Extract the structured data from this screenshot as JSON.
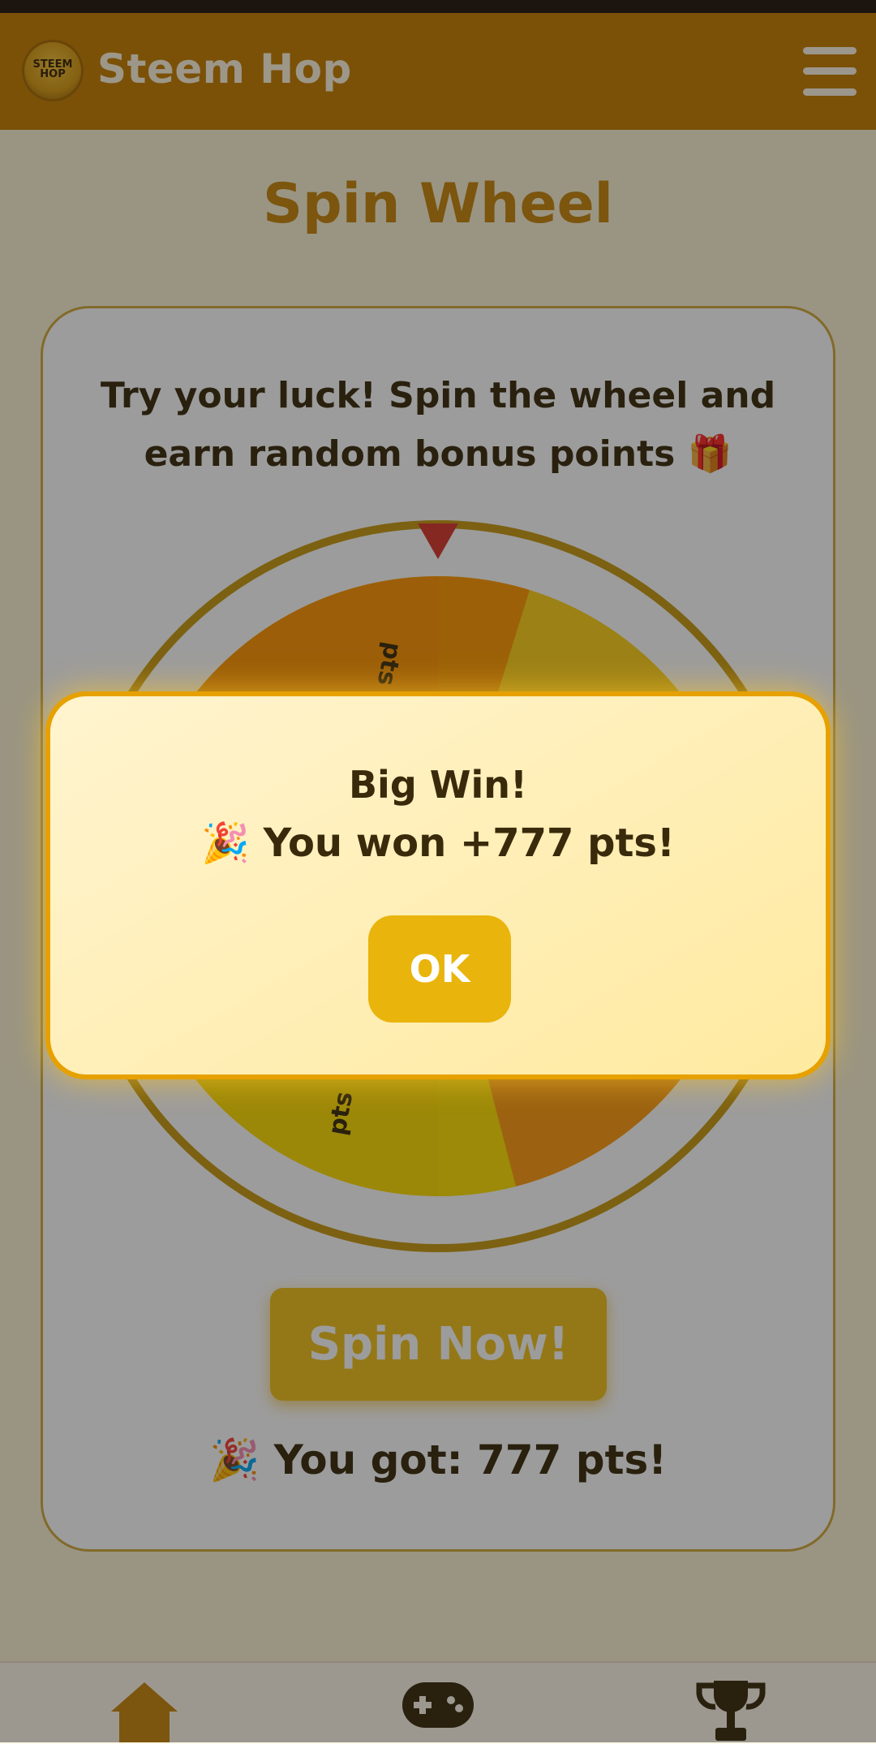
{
  "app": {
    "title": "Steem Hop",
    "logo_text_top": "STEEM",
    "logo_text_bottom": "HOP"
  },
  "page": {
    "title": "Spin Wheel",
    "intro": "Try your luck! Spin the wheel and earn random bonus points 🎁"
  },
  "wheel": {
    "segment_labels": [
      "pts",
      "pts"
    ]
  },
  "spin_button_label": "Spin Now!",
  "result_text": "🎉 You got: 777 pts!",
  "modal": {
    "title": "Big Win!",
    "message": "🎉 You won +777 pts!",
    "ok_label": "OK"
  },
  "bottom_nav": {
    "items": [
      "home-icon",
      "gamepad-icon",
      "trophy-icon"
    ]
  },
  "colors": {
    "appbar": "#c67f00",
    "accent": "#f2c11c",
    "modal_border": "#e6a100",
    "pointer": "#d9372e"
  }
}
